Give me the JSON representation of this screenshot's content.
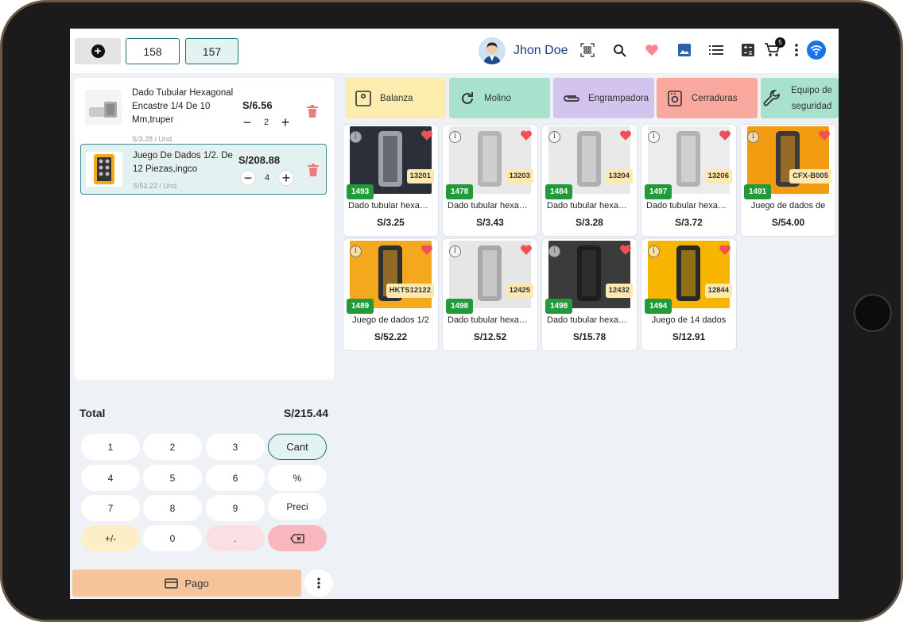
{
  "header": {
    "tickets": [
      "158",
      "157"
    ],
    "user_name": "Jhon Doe",
    "cart_count": "5"
  },
  "cart": {
    "items": [
      {
        "name": "Dado Tubular Hexagonal Encastre 1/4 De 10 Mm,truper",
        "unit_price": "S/3.28 / Und.",
        "line_total": "S/6.56",
        "qty": "2"
      },
      {
        "name": "Juego De Dados 1/2. De 12 Piezas,ingco",
        "unit_price": "S/52.22 / Und.",
        "line_total": "S/208.88",
        "qty": "4"
      }
    ],
    "total_label": "Total",
    "total_value": "S/215.44"
  },
  "keypad": {
    "keys": [
      "1",
      "2",
      "3",
      "Cant",
      "4",
      "5",
      "6",
      "%",
      "7",
      "8",
      "9",
      "Preci",
      "+/-",
      "0",
      "."
    ]
  },
  "pay_label": "Pago",
  "categories": [
    {
      "label": "Balanza",
      "color": "#fcecae"
    },
    {
      "label": "Molino",
      "color": "#a8e2cd"
    },
    {
      "label": "Engrampadora",
      "color": "#d3c4ee"
    },
    {
      "label": "Cerraduras",
      "color": "#f8a89c"
    },
    {
      "label": "Equipo de seguridad",
      "color": "#a8e2cd"
    }
  ],
  "products": [
    {
      "name": "Dado tubular hexagonal",
      "price": "S/3.25",
      "code": "13201",
      "stock": "1493"
    },
    {
      "name": "Dado tubular hexagonal",
      "price": "S/3.43",
      "code": "13203",
      "stock": "1478"
    },
    {
      "name": "Dado tubular hexagonal",
      "price": "S/3.28",
      "code": "13204",
      "stock": "1484"
    },
    {
      "name": "Dado tubular hexagonal",
      "price": "S/3.72",
      "code": "13206",
      "stock": "1497"
    },
    {
      "name": "Juego de dados de",
      "price": "S/54.00",
      "code": "CFX-B005",
      "stock": "1491"
    },
    {
      "name": "Juego de dados 1/2",
      "price": "S/52.22",
      "code": "HKTS12122",
      "stock": "1489"
    },
    {
      "name": "Dado tubular hexagonal",
      "price": "S/12.52",
      "code": "12425",
      "stock": "1498"
    },
    {
      "name": "Dado tubular hexagonal",
      "price": "S/15.78",
      "code": "12432",
      "stock": "1498"
    },
    {
      "name": "Juego de 14 dados",
      "price": "S/12.91",
      "code": "12844",
      "stock": "1494"
    }
  ]
}
